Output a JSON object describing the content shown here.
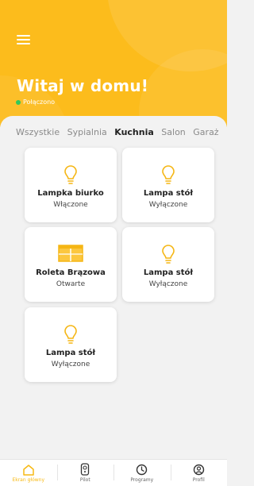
{
  "colors": {
    "accent": "#fcbc1c",
    "online": "#33c85a",
    "background": "#f2f2f2"
  },
  "header": {
    "title": "Witaj w domu!",
    "status": "Połączono",
    "menu_icon": "hamburger-menu-icon"
  },
  "tabs": [
    {
      "label": "Wszystkie",
      "active": false
    },
    {
      "label": "Sypialnia",
      "active": false
    },
    {
      "label": "Kuchnia",
      "active": true
    },
    {
      "label": "Salon",
      "active": false
    },
    {
      "label": "Garaż",
      "active": false
    }
  ],
  "devices": [
    {
      "name": "Lampka biurko",
      "state": "Włączone",
      "icon": "bulb-icon"
    },
    {
      "name": "Lampa stół",
      "state": "Wyłączone",
      "icon": "bulb-icon"
    },
    {
      "name": "Roleta Brązowa",
      "state": "Otwarte",
      "icon": "blind-icon"
    },
    {
      "name": "Lampa stół",
      "state": "Wyłączone",
      "icon": "bulb-icon"
    },
    {
      "name": "Lampa stół",
      "state": "Wyłączone",
      "icon": "bulb-icon"
    }
  ],
  "nav": [
    {
      "label": "Ekran główny",
      "icon": "home-icon",
      "active": true
    },
    {
      "label": "Pilot",
      "icon": "remote-icon",
      "active": false
    },
    {
      "label": "Programy",
      "icon": "clock-icon",
      "active": false
    },
    {
      "label": "Profil",
      "icon": "profile-icon",
      "active": false
    }
  ]
}
